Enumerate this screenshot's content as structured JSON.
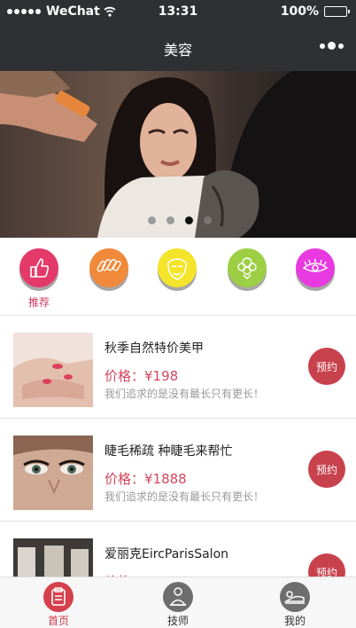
{
  "status_bar": {
    "carrier": "WeChat",
    "time": "13:31",
    "battery": "100%",
    "signal_bars": 5
  },
  "nav": {
    "title": "美容",
    "more_icon": "more-dots-icon"
  },
  "banner": {
    "slide_count": 4,
    "active_slide": 3
  },
  "categories": [
    {
      "icon": "thumbs-up-icon",
      "label": "推荐",
      "color": "#e33a6a",
      "active": true
    },
    {
      "icon": "nails-icon",
      "label": "",
      "color": "#f0893a",
      "active": false
    },
    {
      "icon": "face-icon",
      "label": "",
      "color": "#f4e42a",
      "active": false
    },
    {
      "icon": "hair-icon",
      "label": "",
      "color": "#9ccf44",
      "active": false
    },
    {
      "icon": "eyelash-icon",
      "label": "",
      "color": "#e83ae0",
      "active": false
    }
  ],
  "services": [
    {
      "title": "秋季自然特价美甲",
      "price": "价格：¥198",
      "desc": "我们追求的是没有最长只有更长！",
      "button": "预约"
    },
    {
      "title": "睫毛稀疏 种睫毛来帮忙",
      "price": "价格：¥1888",
      "desc": "我们追求的是没有最长只有更长！",
      "button": "预约"
    },
    {
      "title": "爱丽克EircParisSalon",
      "price": "价格：¥1588",
      "desc": "",
      "button": "预约"
    }
  ],
  "tabbar": [
    {
      "icon": "clipboard-icon",
      "label": "首页",
      "active": true
    },
    {
      "icon": "technician-icon",
      "label": "技师",
      "active": false
    },
    {
      "icon": "profile-icon",
      "label": "我的",
      "active": false
    }
  ],
  "colors": {
    "header_bg": "#2e3033",
    "accent": "#c8424d",
    "price": "#d2465e"
  }
}
